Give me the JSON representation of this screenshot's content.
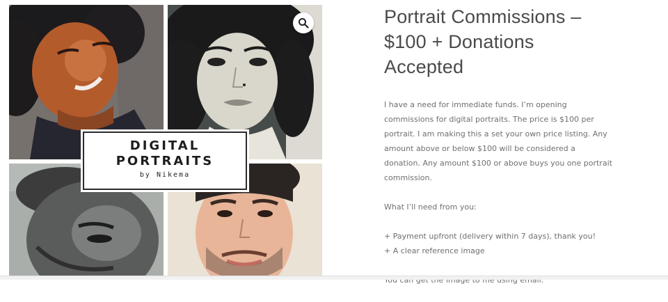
{
  "gallery": {
    "card_line1": "DIGITAL",
    "card_line2": "PORTRAITS",
    "card_line3": "by Nikema",
    "zoom_icon": "search-icon"
  },
  "product": {
    "title_line1": "Portrait Commissions –",
    "title_line2": "$100 + Donations",
    "title_line3": "Accepted",
    "desc_p1": "I have a need for immediate funds. I’m opening commissions for digital portraits. The price is $100 per portrait. I am making this a set your own price listing. Any amount above or below $100 will be considered a donation. Any amount $100 or above buys you one portrait commission.",
    "desc_p2": "What I’ll need from you:",
    "desc_item1": "+ Payment upfront (delivery within 7 days), thank you!",
    "desc_item2": "+ A clear reference image",
    "desc_p3": "You can get the image to me using email."
  },
  "colors": {
    "title_text": "#4a4a4a",
    "body_text": "#6f6f6f"
  }
}
